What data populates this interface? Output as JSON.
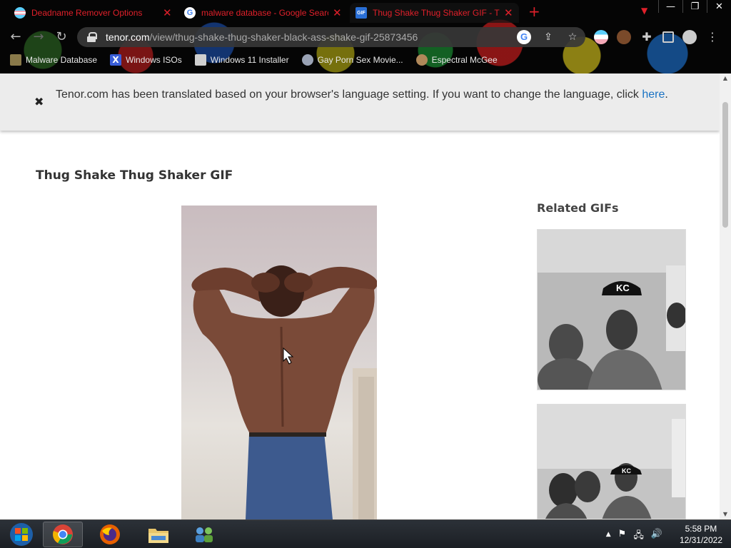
{
  "browser": {
    "tabs": [
      {
        "title": "Deadname Remover Options",
        "favicon": "trans-flag-icon",
        "active": false
      },
      {
        "title": "malware database - Google Search",
        "favicon": "google-icon",
        "active": false
      },
      {
        "title": "Thug Shake Thug Shaker GIF - Thug Shake",
        "favicon": "gif-icon",
        "active": true
      }
    ],
    "new_tab": "+",
    "window_buttons": {
      "minimize": "—",
      "restore": "❐",
      "close": "✕"
    },
    "url_host": "tenor.com",
    "url_path": "/view/thug-shake-thug-shaker-black-ass-shake-gif-25873456",
    "bookmarks": [
      {
        "label": "Malware Database",
        "icon": "malware-icon",
        "color": "#8a7a4a"
      },
      {
        "label": "Windows ISOs",
        "icon": "x-icon",
        "color": "#3a5ed8"
      },
      {
        "label": "Windows 11 Installer",
        "icon": "page-icon",
        "color": "#cfcfcf"
      },
      {
        "label": "Gay Porn Sex Movie...",
        "icon": "globe-icon",
        "color": "#9aa3b5"
      },
      {
        "label": "Espectral McGee",
        "icon": "avatar-icon",
        "color": "#b0885a"
      }
    ]
  },
  "banner": {
    "close_icon": "✖",
    "message": "Tenor.com has been translated based on your browser's language setting. If you want to change the language, click ",
    "link": "here",
    "suffix": "."
  },
  "content": {
    "gif_title": "Thug Shake Thug Shaker GIF",
    "related_title": "Related GIFs"
  },
  "taskbar": {
    "time": "5:58 PM",
    "date": "12/31/2022"
  },
  "colors": {
    "tab_text": "#e0202a",
    "link": "#1a73c4"
  }
}
